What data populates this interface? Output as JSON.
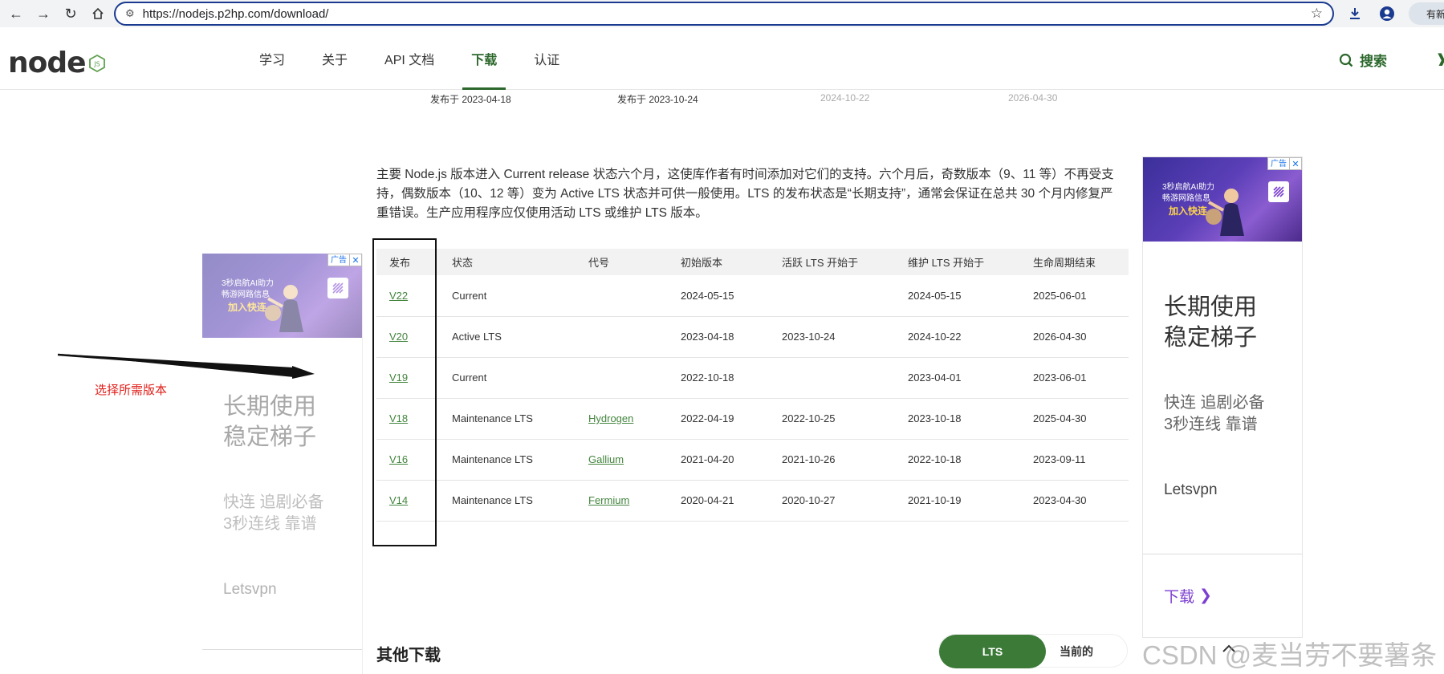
{
  "browser": {
    "url": "https://nodejs.p2hp.com/download/",
    "update_label": "有新版"
  },
  "site": {
    "logo_text": "node",
    "logo_badge": "JS",
    "nav": [
      {
        "label": "学习"
      },
      {
        "label": "关于"
      },
      {
        "label": "API 文档"
      },
      {
        "label": "下载"
      },
      {
        "label": "认证"
      }
    ],
    "search_label": "搜索"
  },
  "schedule_dates": [
    "发布于 2023-04-18",
    "发布于 2023-10-24",
    "2024-10-22",
    "2026-04-30"
  ],
  "intro": "主要 Node.js 版本进入 Current release 状态六个月，这使库作者有时间添加对它们的支持。六个月后，奇数版本（9、11 等）不再受支持，偶数版本（10、12 等）变为 Active LTS 状态并可供一般使用。LTS 的发布状态是“长期支持”，通常会保证在总共 30 个月内修复严重错误。生产应用程序应仅使用活动 LTS 或维护 LTS 版本。",
  "release_table": {
    "headers": [
      "发布",
      "状态",
      "代号",
      "初始版本",
      "活跃 LTS 开始于",
      "维护 LTS 开始于",
      "生命周期结束"
    ],
    "rows": [
      {
        "release": "V22",
        "status": "Current",
        "codename": "",
        "initial": "2024-05-15",
        "active": "",
        "maintenance": "2024-05-15",
        "eol": "2025-06-01"
      },
      {
        "release": "V20",
        "status": "Active LTS",
        "codename": "",
        "initial": "2023-04-18",
        "active": "2023-10-24",
        "maintenance": "2024-10-22",
        "eol": "2026-04-30"
      },
      {
        "release": "V19",
        "status": "Current",
        "codename": "",
        "initial": "2022-10-18",
        "active": "",
        "maintenance": "2023-04-01",
        "eol": "2023-06-01"
      },
      {
        "release": "V18",
        "status": "Maintenance LTS",
        "codename": "Hydrogen",
        "initial": "2022-04-19",
        "active": "2022-10-25",
        "maintenance": "2023-10-18",
        "eol": "2025-04-30"
      },
      {
        "release": "V16",
        "status": "Maintenance LTS",
        "codename": "Gallium",
        "initial": "2021-04-20",
        "active": "2021-10-26",
        "maintenance": "2022-10-18",
        "eol": "2023-09-11"
      },
      {
        "release": "V14",
        "status": "Maintenance LTS",
        "codename": "Fermium",
        "initial": "2020-04-21",
        "active": "2020-10-27",
        "maintenance": "2021-10-19",
        "eol": "2023-04-30"
      }
    ]
  },
  "ad": {
    "badge": "广告",
    "close": "✕",
    "banner_line1": "3秒启航AI助力",
    "banner_line2": "畅游网路信息",
    "banner_cta": "加入快连",
    "title_line1": "长期使用",
    "title_line2": "稳定梯子",
    "sub_line1": "快连 追剧必备",
    "sub_line2": "3秒连线 靠谱",
    "brand": "Letsvpn",
    "download": "下载"
  },
  "annotation": {
    "label": "选择所需版本",
    "color": "#e0201b"
  },
  "other_downloads": {
    "title": "其他下载",
    "tab_lts": "LTS",
    "tab_current": "当前的"
  },
  "watermark": "CSDN @麦当劳不要薯条",
  "colors": {
    "brand_green": "#2c682c",
    "link_green": "#43853d",
    "toggle_green": "#3c7a38",
    "ad_purple": "#7b3fd1"
  }
}
